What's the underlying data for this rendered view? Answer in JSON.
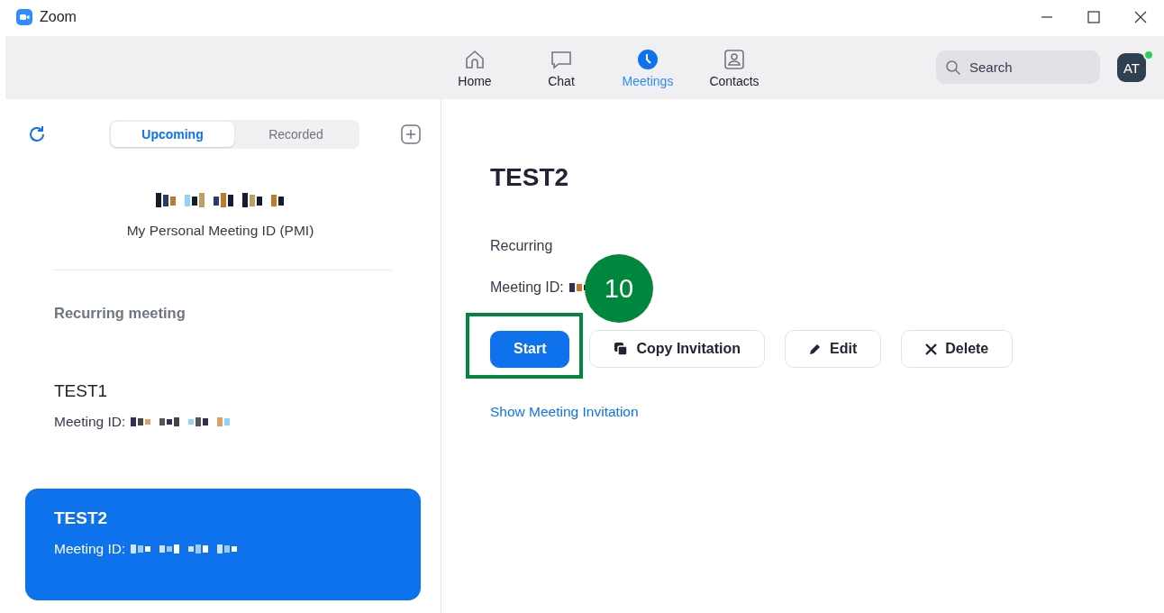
{
  "window": {
    "title": "Zoom"
  },
  "nav_tabs": [
    {
      "label": "Home",
      "kind": "home",
      "selected": false
    },
    {
      "label": "Chat",
      "kind": "chat",
      "selected": false
    },
    {
      "label": "Meetings",
      "kind": "meetings",
      "selected": true
    },
    {
      "label": "Contacts",
      "kind": "contacts",
      "selected": false
    }
  ],
  "search": {
    "placeholder": "Search"
  },
  "avatar": {
    "initials": "AT",
    "online": true
  },
  "list_tabs": [
    {
      "label": "Upcoming",
      "selected": true
    },
    {
      "label": "Recorded",
      "selected": false
    }
  ],
  "pmi": {
    "caption": "My Personal Meeting ID (PMI)"
  },
  "section_heading": "Recurring meeting",
  "meetings": [
    {
      "title": "TEST1",
      "id_label": "Meeting ID:",
      "selected": false
    },
    {
      "title": "TEST2",
      "id_label": "Meeting ID:",
      "selected": true
    }
  ],
  "detail": {
    "title": "TEST2",
    "recurrence": "Recurring",
    "id_label": "Meeting ID:",
    "buttons": [
      {
        "label": "Start",
        "kind": "primary",
        "highlighted": true
      },
      {
        "label": "Copy Invitation",
        "kind": "copy",
        "highlighted": false
      },
      {
        "label": "Edit",
        "kind": "edit",
        "highlighted": false
      },
      {
        "label": "Delete",
        "kind": "delete",
        "highlighted": false
      }
    ],
    "link": "Show Meeting Invitation"
  },
  "callout": {
    "number": "10"
  }
}
